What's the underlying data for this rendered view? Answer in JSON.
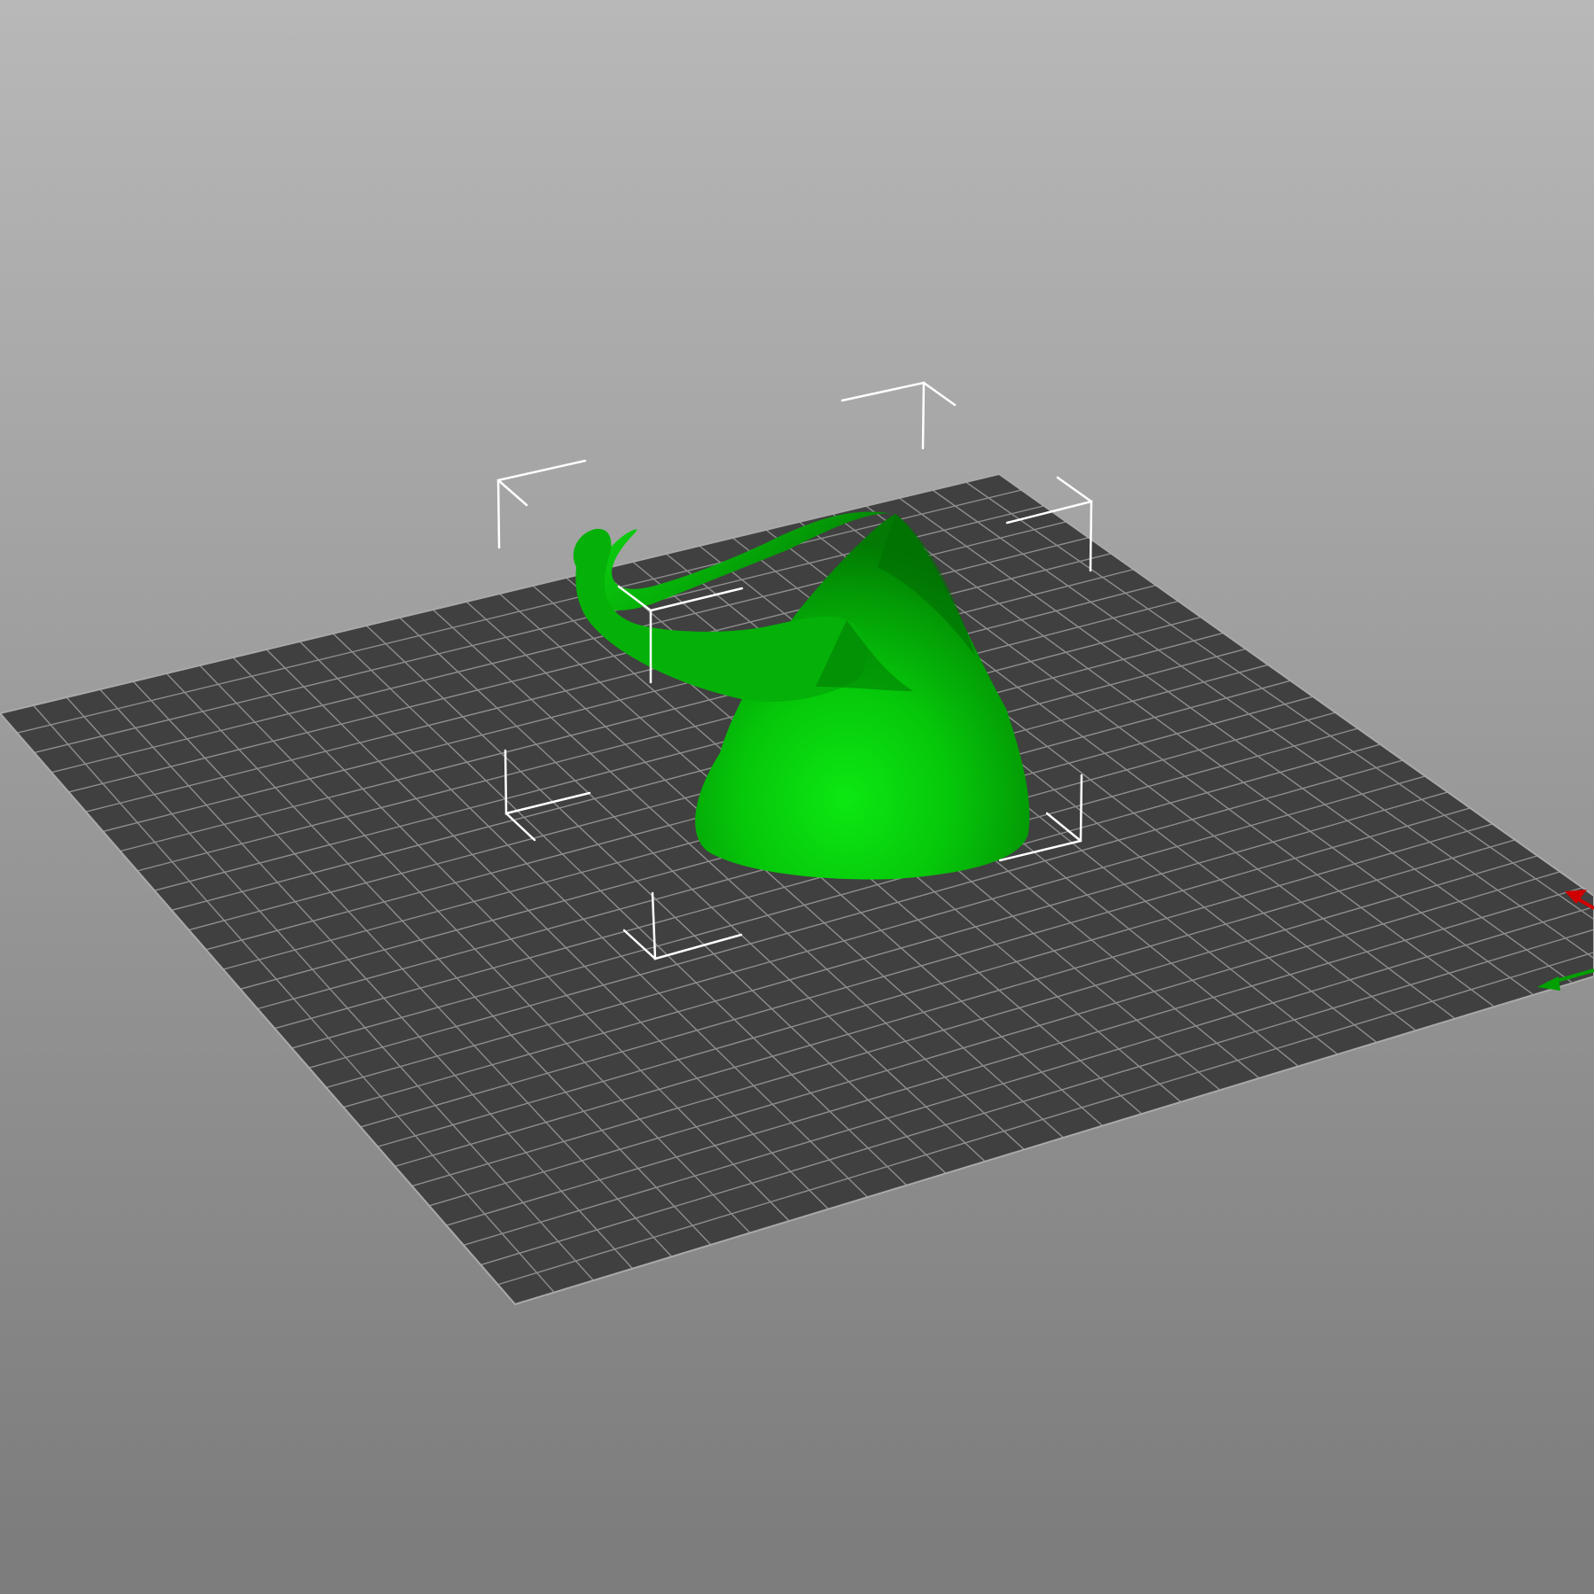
{
  "viewport": {
    "background_top": "#b8b8b8",
    "background_bottom": "#7b7b7b"
  },
  "bed": {
    "fill": "#404040",
    "grid_color": "#8e8e8e",
    "edge_color": "#a9a9a9"
  },
  "model": {
    "name_icon": "gnome-hat-model",
    "color": "#08c40c",
    "state": "selected"
  },
  "axes": {
    "x_color": "#d00000",
    "y_color": "#00a000"
  }
}
